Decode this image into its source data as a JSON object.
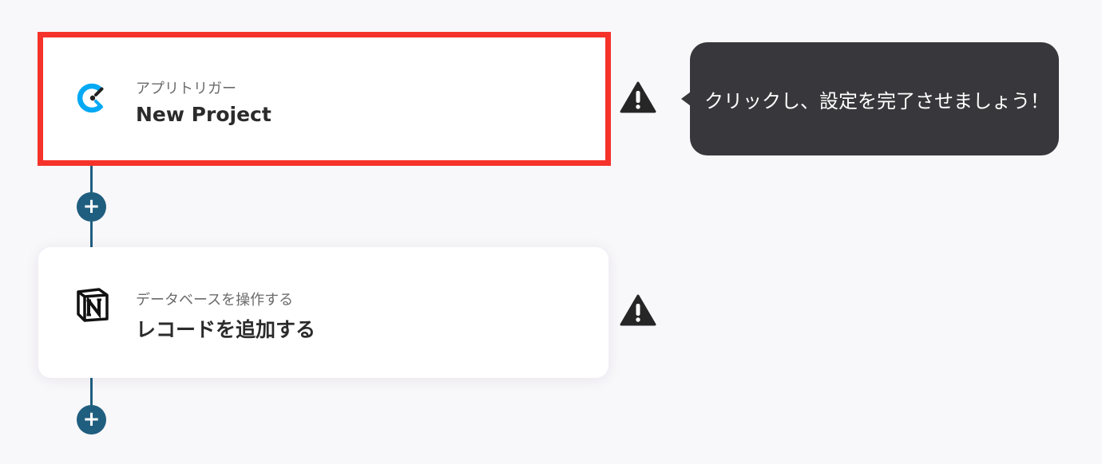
{
  "flow": {
    "steps": [
      {
        "app": "clockify",
        "icon": "clockify-logo-icon",
        "subtitle": "アプリトリガー",
        "title": "New Project",
        "status": "warning",
        "highlighted": true
      },
      {
        "app": "notion",
        "icon": "notion-logo-icon",
        "subtitle": "データベースを操作する",
        "title": "レコードを追加する",
        "status": "warning",
        "highlighted": false
      }
    ],
    "add_button_label": "+",
    "connector_color": "#1f5e7f"
  },
  "tooltip": {
    "text": "クリックし、設定を完了させましょう！"
  },
  "colors": {
    "highlight_border": "#f5332a",
    "tooltip_bg": "#38373b",
    "clockify_blue": "#03a9f4",
    "background": "#f8f7fa"
  }
}
